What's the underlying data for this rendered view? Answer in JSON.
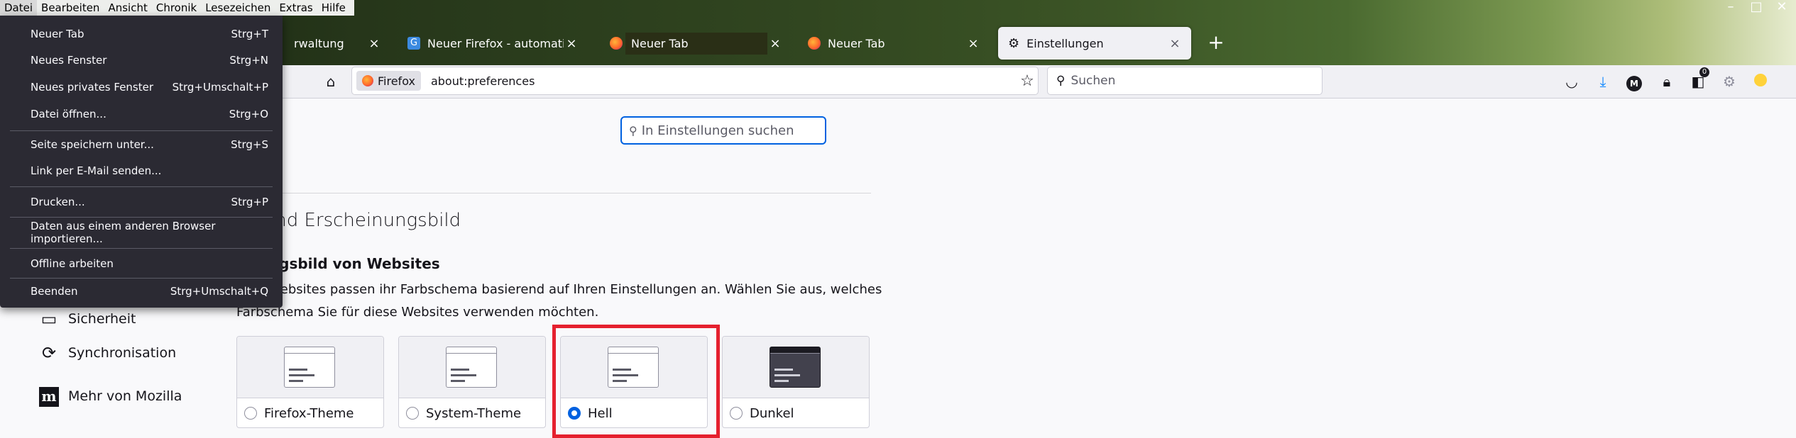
{
  "menubar": [
    "Datei",
    "Bearbeiten",
    "Ansicht",
    "Chronik",
    "Lesezeichen",
    "Extras",
    "Hilfe"
  ],
  "window_controls": {
    "minimize": "–",
    "maximize": "□",
    "close": "✕"
  },
  "tabs": [
    {
      "label": "rwaltung",
      "close": "×"
    },
    {
      "label": "Neuer Firefox - automatischer D",
      "close": "×"
    },
    {
      "label": "Neuer Tab",
      "close": "×"
    },
    {
      "label": "Neuer Tab",
      "close": "×"
    },
    {
      "label": "Einstellungen",
      "close": "×"
    }
  ],
  "new_tab": "+",
  "navbar": {
    "identity_label": "Firefox",
    "url": "about:preferences",
    "search_placeholder": "Suchen",
    "extension_badge": "0"
  },
  "preferences": {
    "search_placeholder": "In Einstellungen suchen",
    "section_title": "he und Erscheinungsbild",
    "subsection_title": "einungsbild von Websites",
    "description_line1": "Websites passen ihr Farbschema basierend auf Ihren Einstellungen an. Wählen Sie aus, welches",
    "description_line2": "Farbschema Sie für diese Websites verwenden möchten.",
    "themes": [
      {
        "label": "Firefox-Theme",
        "selected": false
      },
      {
        "label": "System-Theme",
        "selected": false
      },
      {
        "label": "Hell",
        "selected": true
      },
      {
        "label": "Dunkel",
        "selected": false
      }
    ]
  },
  "sidebar": {
    "items": [
      {
        "label": "Sicherheit"
      },
      {
        "label": "Synchronisation"
      },
      {
        "label": "Mehr von Mozilla"
      }
    ]
  },
  "file_menu": {
    "items": [
      {
        "label": "Neuer Tab",
        "shortcut": "Strg+T"
      },
      {
        "label": "Neues Fenster",
        "shortcut": "Strg+N"
      },
      {
        "label": "Neues privates Fenster",
        "shortcut": "Strg+Umschalt+P"
      },
      {
        "label": "Datei öffnen...",
        "shortcut": "Strg+O"
      },
      {
        "label": "Seite speichern unter...",
        "shortcut": "Strg+S"
      },
      {
        "label": "Link per E-Mail senden...",
        "shortcut": ""
      },
      {
        "label": "Drucken...",
        "shortcut": "Strg+P"
      },
      {
        "label": "Daten aus einem anderen Browser importieren...",
        "shortcut": ""
      },
      {
        "label": "Offline arbeiten",
        "shortcut": ""
      },
      {
        "label": "Beenden",
        "shortcut": "Strg+Umschalt+Q"
      }
    ]
  },
  "colors": {
    "accent": "#0061e0",
    "highlight": "#e5202e",
    "menu_bg": "#2b2a33"
  }
}
